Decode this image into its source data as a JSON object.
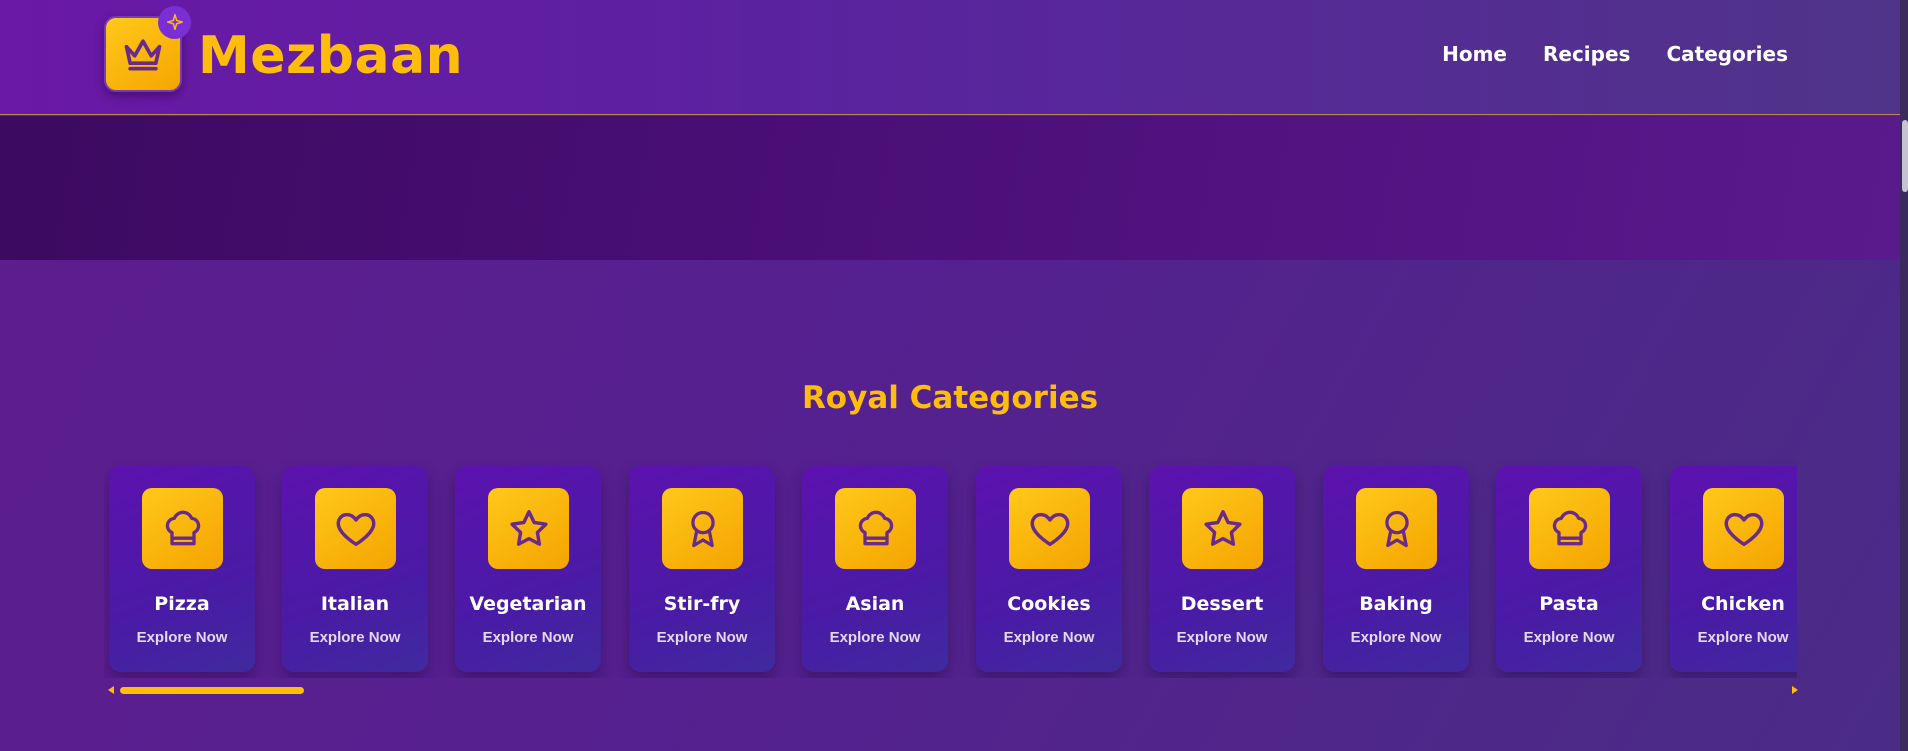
{
  "brand": {
    "name": "Mezbaan",
    "logo_icon": "crown-icon",
    "badge_icon": "sparkle-icon"
  },
  "nav": [
    {
      "label": "Home"
    },
    {
      "label": "Recipes"
    },
    {
      "label": "Categories"
    }
  ],
  "section": {
    "title": "Royal Categories"
  },
  "categories": [
    {
      "name": "Pizza",
      "cta": "Explore Now",
      "icon": "chef-hat-icon"
    },
    {
      "name": "Italian",
      "cta": "Explore Now",
      "icon": "heart-icon"
    },
    {
      "name": "Vegetarian",
      "cta": "Explore Now",
      "icon": "star-icon"
    },
    {
      "name": "Stir-fry",
      "cta": "Explore Now",
      "icon": "award-icon"
    },
    {
      "name": "Asian",
      "cta": "Explore Now",
      "icon": "chef-hat-icon"
    },
    {
      "name": "Cookies",
      "cta": "Explore Now",
      "icon": "heart-icon"
    },
    {
      "name": "Dessert",
      "cta": "Explore Now",
      "icon": "star-icon"
    },
    {
      "name": "Baking",
      "cta": "Explore Now",
      "icon": "award-icon"
    },
    {
      "name": "Pasta",
      "cta": "Explore Now",
      "icon": "chef-hat-icon"
    },
    {
      "name": "Chicken",
      "cta": "Explore Now",
      "icon": "heart-icon"
    }
  ],
  "colors": {
    "accent": "#ffbd0b",
    "card": "#5c12ae",
    "header": "#5b22a0"
  },
  "carousel": {
    "scroll_position": 0.0
  }
}
